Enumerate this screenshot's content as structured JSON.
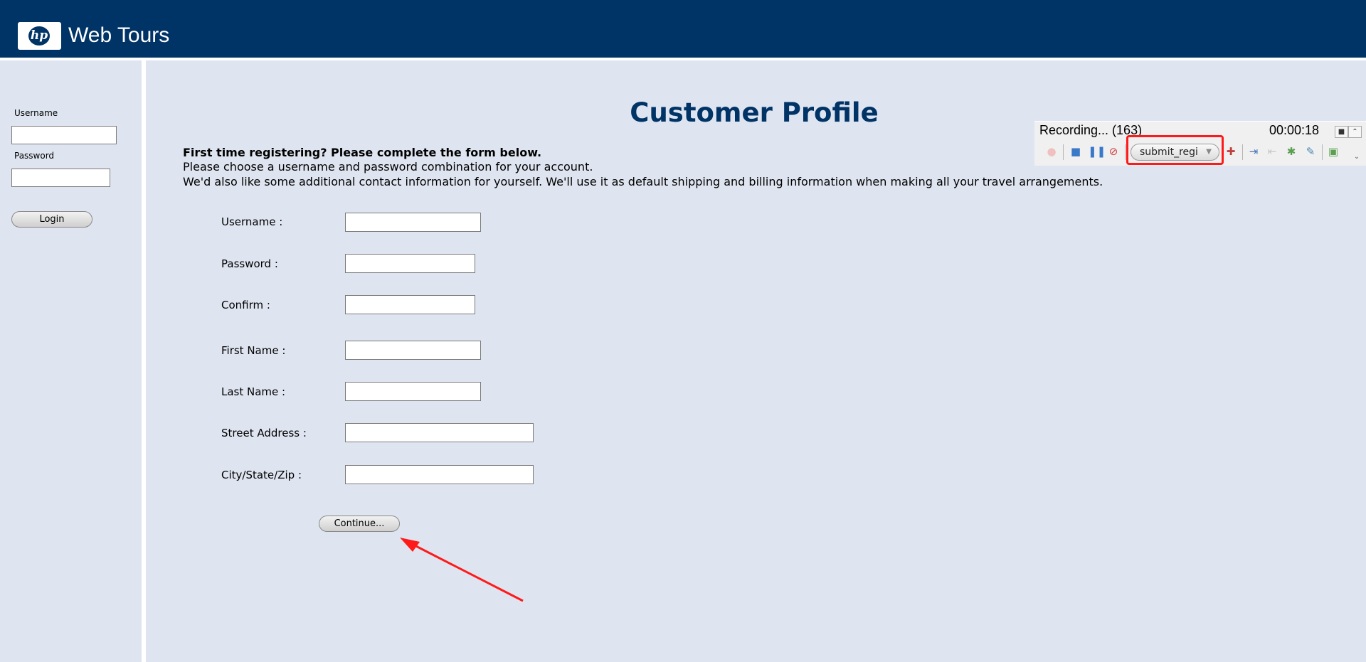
{
  "header": {
    "logo_text": "hp",
    "brand": "Web Tours",
    "colors": {
      "bar": "#003366"
    }
  },
  "sidebar": {
    "username_label": "Username",
    "password_label": "Password",
    "login_button": "Login"
  },
  "main": {
    "title": "Customer Profile",
    "intro_bold": "First time registering? Please complete the form below.",
    "intro_line1": "Please choose a username and password combination for your account.",
    "intro_line2": "We'd also like some additional contact information for yourself. We'll use it as default shipping and billing information when making all your travel arrangements.",
    "fields": [
      {
        "label": "Username :",
        "value": ""
      },
      {
        "label": "Password :",
        "value": ""
      },
      {
        "label": "Confirm :",
        "value": ""
      },
      {
        "label": "First Name :",
        "value": ""
      },
      {
        "label": "Last Name :",
        "value": ""
      },
      {
        "label": "Street Address :",
        "value": ""
      },
      {
        "label": "City/State/Zip :",
        "value": ""
      }
    ],
    "continue_button": "Continue..."
  },
  "recorder": {
    "status": "Recording... (163)",
    "elapsed": "00:00:18",
    "step_select": "submit_regi",
    "icons": [
      "record-icon",
      "stop-icon",
      "pause-icon",
      "cancel-recording-icon",
      "insert-step-icon",
      "start-transaction-icon",
      "end-transaction-icon",
      "rendezvous-icon",
      "comment-icon",
      "snapshot-icon"
    ]
  },
  "annotation": {
    "highlight_color": "#ff1a1a"
  }
}
